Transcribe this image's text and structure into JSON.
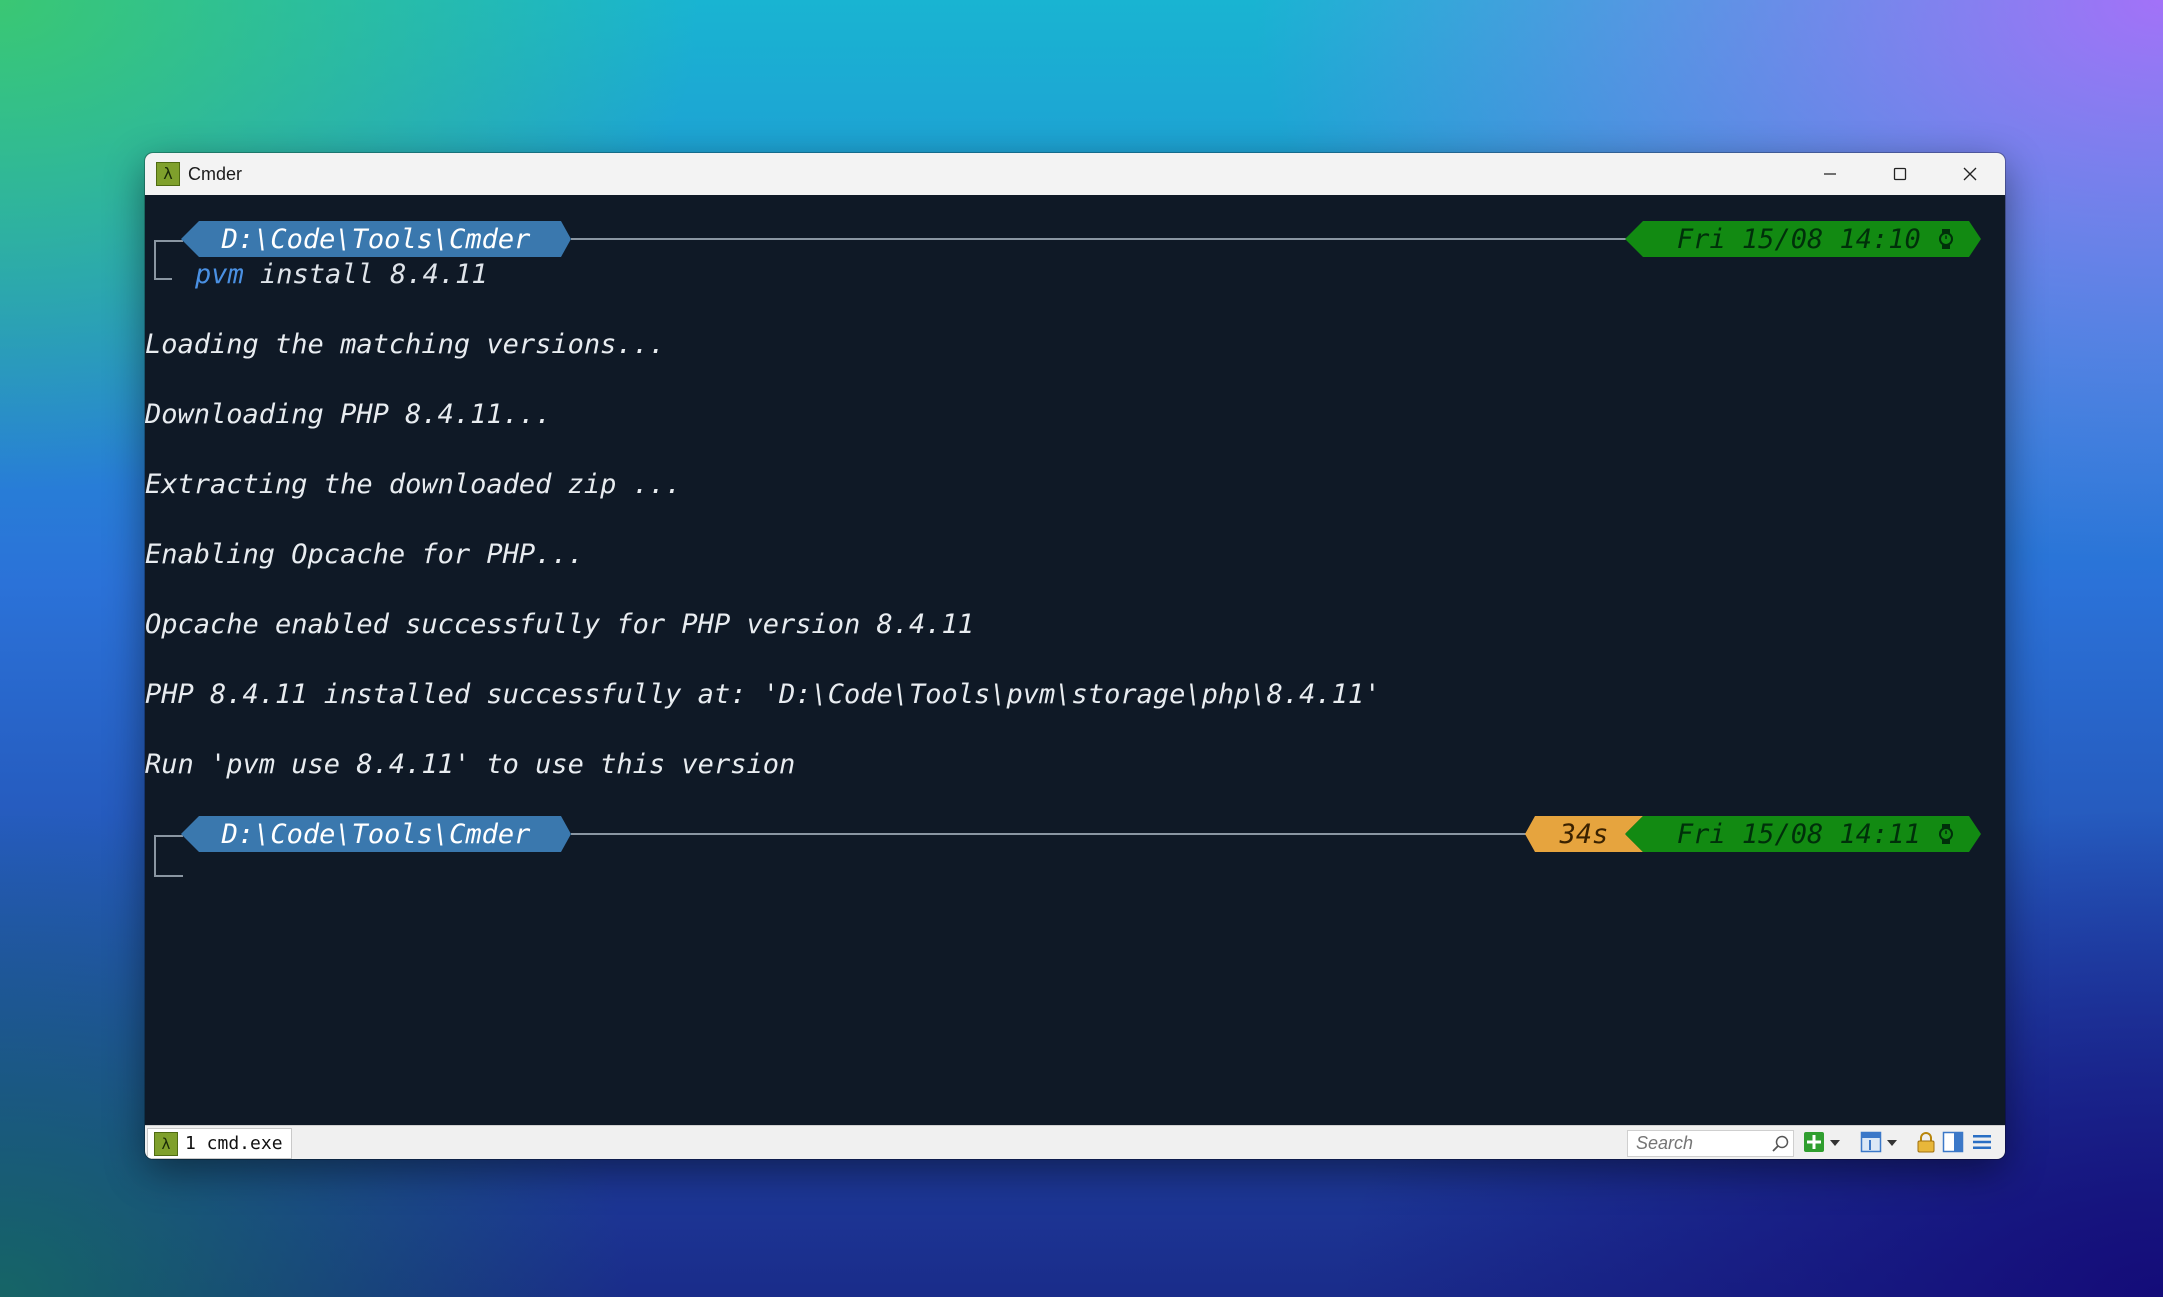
{
  "window": {
    "title": "Cmder",
    "app_icon": "λ"
  },
  "controls": [
    "minimize-icon",
    "maximize-icon",
    "close-icon"
  ],
  "prompt1": {
    "path": "D:\\Code\\Tools\\Cmder",
    "command": "pvm",
    "args": " install 8.4.11",
    "time": "Fri 15/08 14:10 "
  },
  "output": [
    "Loading the matching versions...",
    "Downloading PHP 8.4.11...",
    "Extracting the downloaded zip ...",
    "Enabling Opcache for PHP...",
    "Opcache enabled successfully for PHP version 8.4.11",
    "PHP 8.4.11 installed successfully at: 'D:\\Code\\Tools\\pvm\\storage\\php\\8.4.11'",
    "Run 'pvm use 8.4.11' to use this version"
  ],
  "prompt2": {
    "path": "D:\\Code\\Tools\\Cmder",
    "duration": "34s",
    "time": "Fri 15/08 14:11 "
  },
  "statusbar": {
    "tab_icon": "λ",
    "tab_label": "1 cmd.exe",
    "search_placeholder": "Search"
  },
  "colors": {
    "terminal_bg": "#0f1926",
    "path_segment": "#3a78ae",
    "time_segment": "#128a12",
    "duration_segment": "#e6a43e",
    "command": "#4a90e2",
    "text": "#e8ecf0"
  }
}
